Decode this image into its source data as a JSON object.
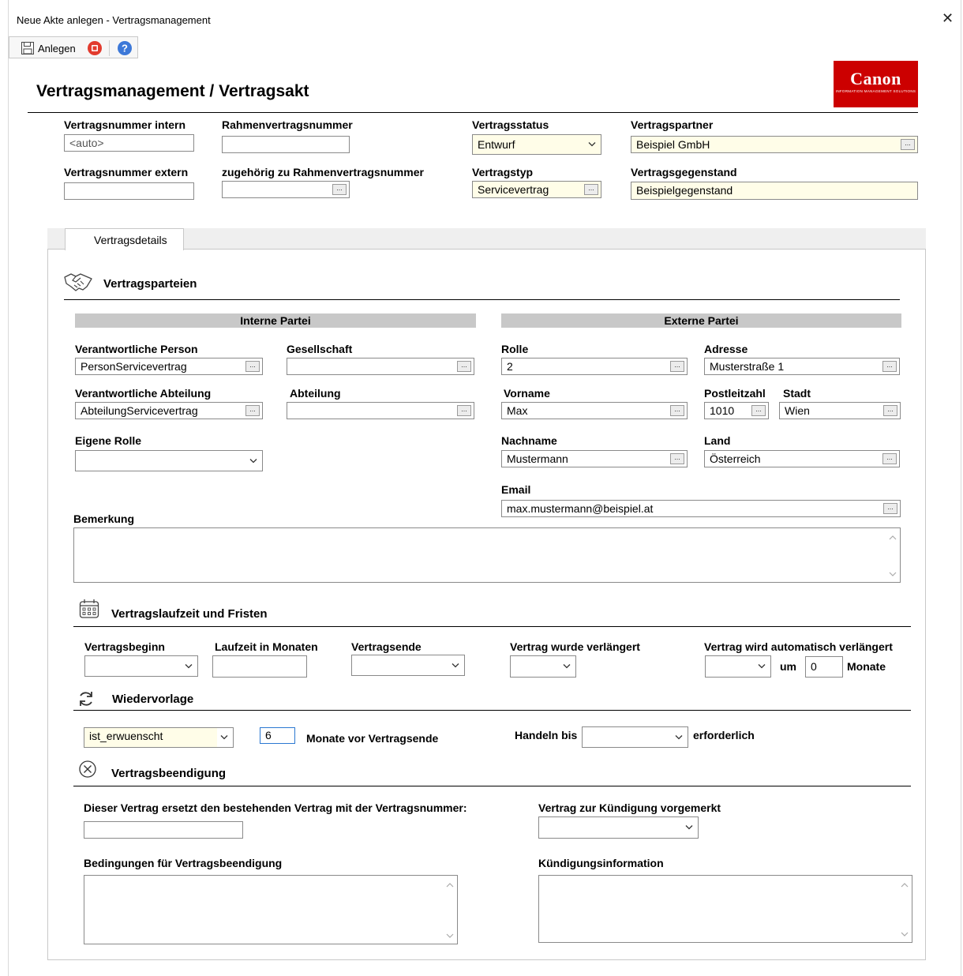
{
  "window": {
    "title": "Neue Akte anlegen - Vertragsmanagement",
    "close_glyph": "✕"
  },
  "toolbar": {
    "anlegen_label": "Anlegen"
  },
  "page": {
    "title": "Vertragsmanagement / Vertragsakt"
  },
  "logo": {
    "brand": "Canon",
    "sub": "INFORMATION MANAGEMENT SOLUTIONS"
  },
  "header_fields": {
    "vertragsnummer_intern": {
      "label": "Vertragsnummer intern",
      "value": "<auto>"
    },
    "rahmenvertragsnummer": {
      "label": "Rahmenvertragsnummer",
      "value": ""
    },
    "vertragsstatus": {
      "label": "Vertragsstatus",
      "value": "Entwurf"
    },
    "vertragspartner": {
      "label": "Vertragspartner",
      "value": "Beispiel GmbH"
    },
    "vertragsnummer_extern": {
      "label": "Vertragsnummer extern",
      "value": ""
    },
    "zugehoerig_rahmen": {
      "label": "zugehörig zu Rahmenvertragsnummer",
      "value": ""
    },
    "vertragstyp": {
      "label": "Vertragstyp",
      "value": "Servicevertrag"
    },
    "vertragsgegenstand": {
      "label": "Vertragsgegenstand",
      "value": "Beispielgegenstand"
    }
  },
  "tabs": [
    {
      "label": "Vertragsdetails"
    }
  ],
  "parteien": {
    "title": "Vertragsparteien",
    "intern_header": "Interne Partei",
    "extern_header": "Externe Partei",
    "verantwortliche_person": {
      "label": "Verantwortliche Person",
      "value": "PersonServicevertrag"
    },
    "gesellschaft": {
      "label": "Gesellschaft",
      "value": ""
    },
    "verantwortliche_abteilung": {
      "label": "Verantwortliche Abteilung",
      "value": "AbteilungServicevertrag"
    },
    "abteilung": {
      "label": "Abteilung",
      "value": ""
    },
    "eigene_rolle": {
      "label": "Eigene Rolle",
      "value": ""
    },
    "rolle": {
      "label": "Rolle",
      "value": "2"
    },
    "adresse": {
      "label": "Adresse",
      "value": "Musterstraße 1"
    },
    "vorname": {
      "label": "Vorname",
      "value": "Max"
    },
    "postleitzahl": {
      "label": "Postleitzahl",
      "value": "1010"
    },
    "stadt": {
      "label": "Stadt",
      "value": "Wien"
    },
    "nachname": {
      "label": "Nachname",
      "value": "Mustermann"
    },
    "land": {
      "label": "Land",
      "value": "Österreich"
    },
    "email": {
      "label": "Email",
      "value": "max.mustermann@beispiel.at"
    },
    "bemerkung": {
      "label": "Bemerkung",
      "value": ""
    }
  },
  "laufzeit": {
    "title": "Vertragslaufzeit und Fristen",
    "vertragsbeginn": {
      "label": "Vertragsbeginn",
      "value": ""
    },
    "laufzeit_monate": {
      "label": "Laufzeit in Monaten",
      "value": ""
    },
    "vertragsende": {
      "label": "Vertragsende",
      "value": ""
    },
    "verlaengert": {
      "label": "Vertrag wurde verlängert",
      "value": ""
    },
    "auto_verlaengert": {
      "label": "Vertrag wird automatisch verlängert",
      "value": "",
      "um_label": "um",
      "monate_value": "0",
      "monate_label": "Monate"
    }
  },
  "wiedervorlage": {
    "title": "Wiedervorlage",
    "status_value": "ist_erwuenscht",
    "monate_value": "6",
    "monate_label": "Monate vor Vertragsende",
    "handeln_label": "Handeln bis",
    "handeln_value": "",
    "erforderlich_label": "erforderlich"
  },
  "beendigung": {
    "title": "Vertragsbeendigung",
    "ersetzt": {
      "label": "Dieser Vertrag ersetzt den bestehenden Vertrag mit der Vertragsnummer:",
      "value": ""
    },
    "kuendigung_vorgemerkt": {
      "label": "Vertrag zur Kündigung vorgemerkt",
      "value": ""
    },
    "bedingungen": {
      "label": "Bedingungen für Vertragsbeendigung",
      "value": ""
    },
    "kuendigungsinfo": {
      "label": "Kündigungsinformation",
      "value": ""
    }
  },
  "colors": {
    "required_bg": "#fffde8",
    "brand_red": "#cc0000",
    "section_bar": "#c8c8c8",
    "focus_blue": "#2b78d1"
  }
}
